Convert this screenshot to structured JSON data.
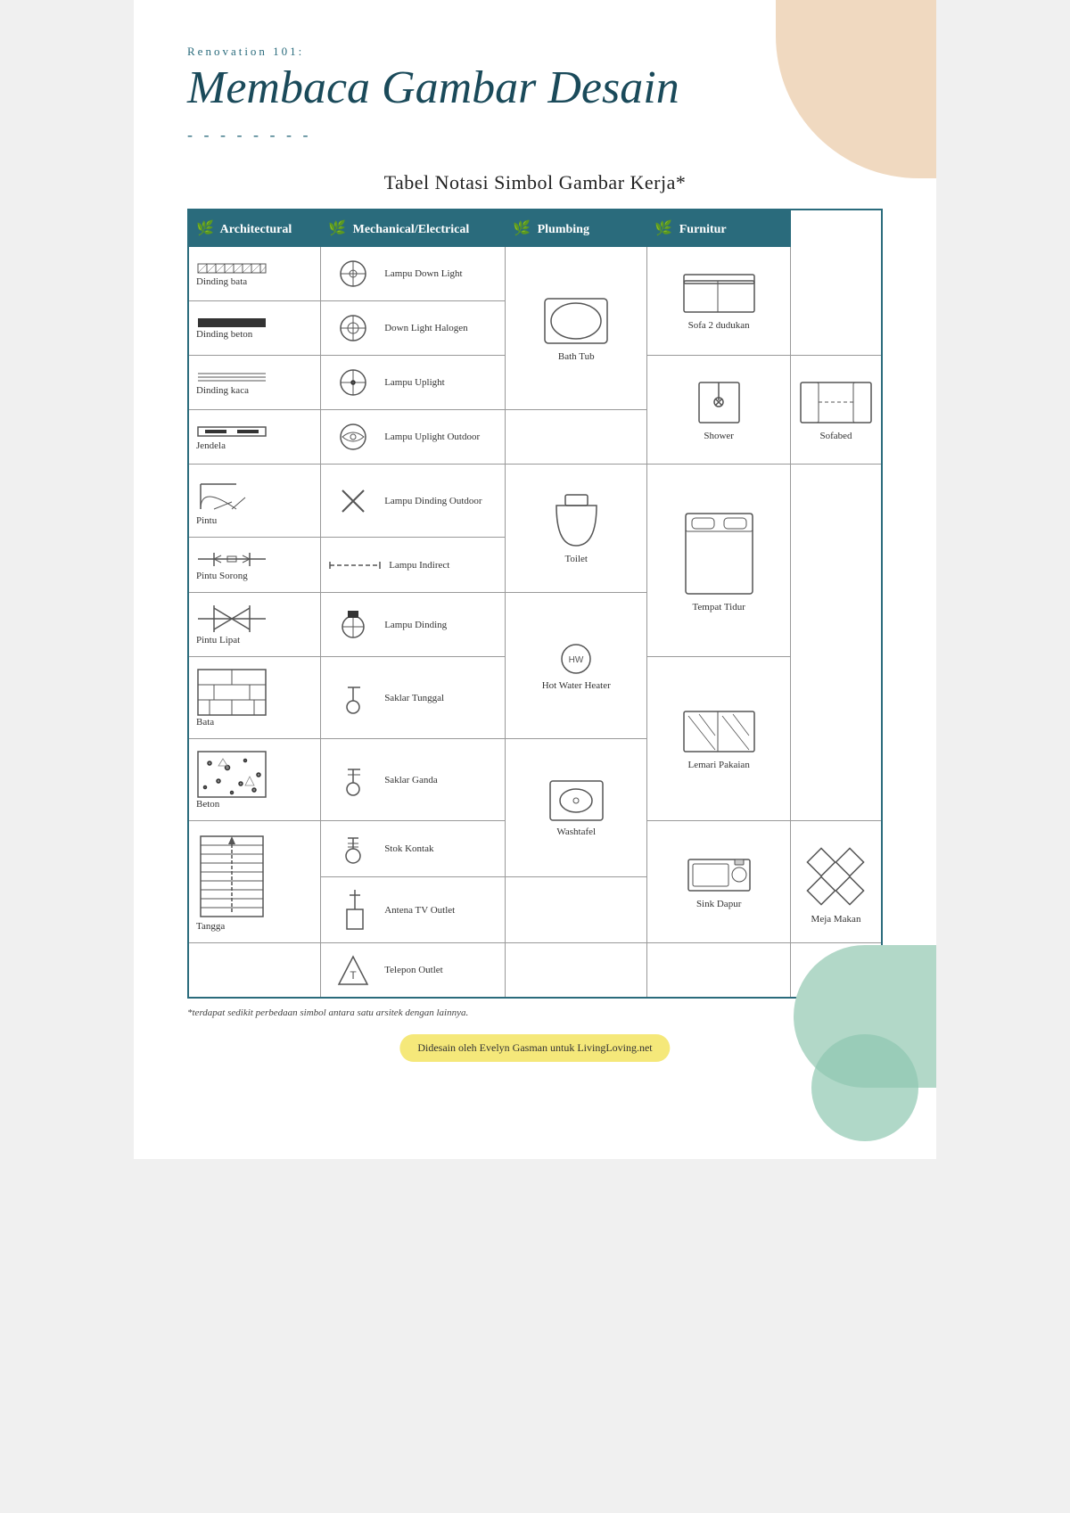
{
  "header": {
    "subtitle": "Renovation 101:",
    "title": "Membaca Gambar Desain",
    "dots": "- - - - - - - -"
  },
  "section_title": "Tabel Notasi Simbol Gambar Kerja*",
  "columns": {
    "architectural": "Architectural",
    "mechanical": "Mechanical/Electrical",
    "plumbing": "Plumbing",
    "furnitur": "Furnitur"
  },
  "architectural_items": [
    "Dinding bata",
    "Dinding beton",
    "Dinding kaca",
    "Jendela",
    "Pintu",
    "Pintu Sorong",
    "Pintu Lipat",
    "Bata",
    "Beton",
    "Tangga"
  ],
  "mechanical_items": [
    "Lampu Down Light",
    "Down Light Halogen",
    "Lampu Uplight",
    "Lampu Uplight Outdoor",
    "Lampu Dinding Outdoor",
    "Lampu Indirect",
    "Lampu Dinding",
    "Saklar Tunggal",
    "Saklar Ganda",
    "Stok Kontak",
    "Antena TV Outlet",
    "Telepon Outlet"
  ],
  "plumbing_items": [
    "Bath Tub",
    "Shower",
    "Toilet",
    "Hot Water Heater",
    "Washtafel",
    "Sink Dapur"
  ],
  "furnitur_items": [
    "Sofa 2 dudukan",
    "Sofabed",
    "Tempat Tidur",
    "Lemari Pakaian",
    "Meja Makan"
  ],
  "footer_note": "*terdapat sedikit perbedaan simbol antara satu arsitek dengan lainnya.",
  "footer_credit": "Didesain oleh Evelyn Gasman untuk LivingLoving.net"
}
